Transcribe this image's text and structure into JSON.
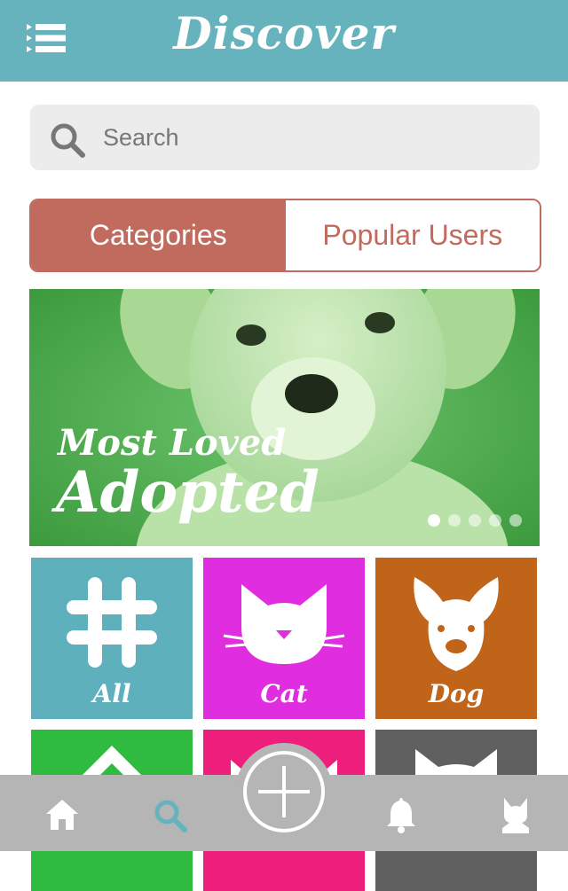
{
  "header": {
    "title": "Discover",
    "menu_icon": "menu-list-icon",
    "background": "#66b3bd"
  },
  "search": {
    "placeholder": "Search",
    "value": "",
    "icon": "search-icon"
  },
  "segment": {
    "tabs": [
      {
        "label": "Categories",
        "active": true
      },
      {
        "label": "Popular Users",
        "active": false
      }
    ],
    "accent": "#c06b5e"
  },
  "banner": {
    "line1": "Most Loved",
    "line2": "Adopted",
    "image": "puppy-photo",
    "slides_total": 5,
    "active_slide": 1
  },
  "categories": [
    {
      "label": "All",
      "icon": "hashtag-icon",
      "color": "#5fb0bd"
    },
    {
      "label": "Cat",
      "icon": "cat-face-icon",
      "color": "#e02de0"
    },
    {
      "label": "Dog",
      "icon": "dog-face-icon",
      "color": "#c0641a"
    },
    {
      "label": "",
      "icon": "diamond-icon",
      "color": "#2fbb3f"
    },
    {
      "label": "",
      "icon": "animal-face-icon",
      "color": "#ee1f7c"
    },
    {
      "label": "",
      "icon": "cat-face-icon",
      "color": "#606060"
    }
  ],
  "tabbar": {
    "items": [
      {
        "icon": "home-icon",
        "active": false
      },
      {
        "icon": "search-icon",
        "active": true
      },
      {
        "icon": "add-icon",
        "active": false
      },
      {
        "icon": "bell-icon",
        "active": false
      },
      {
        "icon": "cat-profile-icon",
        "active": false
      }
    ],
    "active_color": "#66b3bd"
  }
}
